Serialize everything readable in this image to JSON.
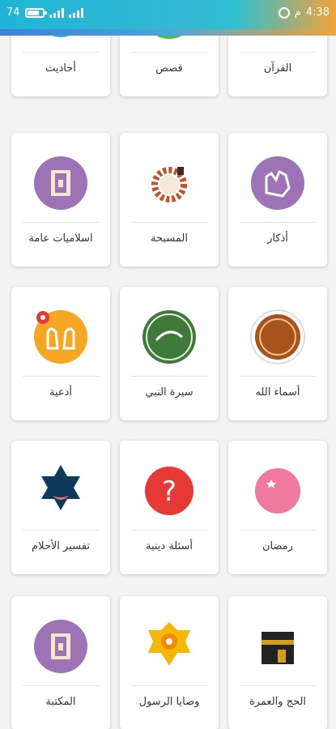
{
  "status": {
    "battery": "74",
    "time": "4:38",
    "time_suffix": "م"
  },
  "rows": [
    [
      "أحاديث",
      "قصص",
      "القرآن"
    ],
    [
      "اسلاميات عامة",
      "المسبحة",
      "أذكار"
    ],
    [
      "أدعية",
      "سيرة النبي",
      "أسماء الله"
    ],
    [
      "تفسير الأحلام",
      "أسئلة دينية",
      "رمضان"
    ],
    [
      "المكتبة",
      "وصايا الرسول",
      "الحج والعمرة"
    ]
  ],
  "icons": {
    "r0c0": "hadith-icon",
    "r0c1": "stories-icon",
    "r0c2": "quran-icon",
    "r1c0": "book-icon",
    "r1c1": "rosary-icon",
    "r1c2": "dhikr-hand-icon",
    "r2c0": "dua-hands-icon",
    "r2c1": "muhammad-seal-icon",
    "r2c2": "allah-names-icon",
    "r3c0": "dream-interpretation-icon",
    "r3c1": "question-icon",
    "r3c2": "crescent-star-icon",
    "r4c0": "library-book-icon",
    "r4c1": "ornament-icon",
    "r4c2": "kaaba-icon"
  }
}
